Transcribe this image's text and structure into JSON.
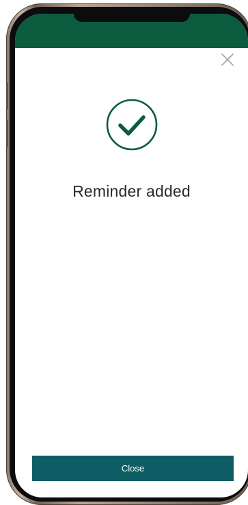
{
  "app": {
    "brand_color": "#0b5b3f",
    "button_color": "#0f5d64",
    "text_color": "#2b2b2b"
  },
  "dialog": {
    "status_icon": "check-circle-icon",
    "dismiss_icon": "close-icon",
    "message": "Reminder added",
    "close_label": "Close"
  }
}
